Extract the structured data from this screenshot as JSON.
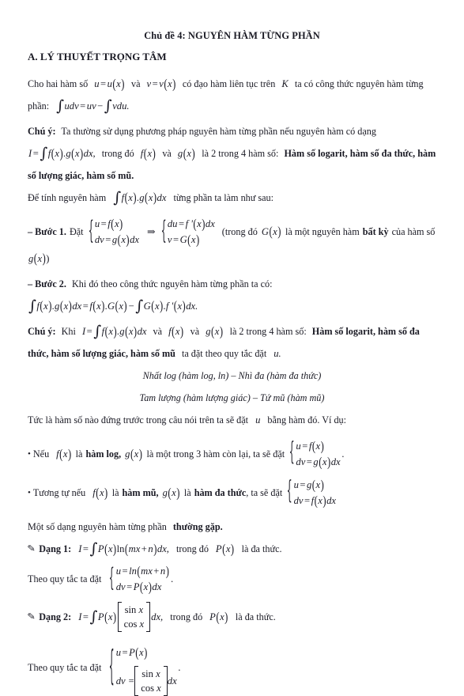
{
  "document": {
    "title": "Chủ đề 4: NGUYÊN HÀM TỪNG PHẦN",
    "section_heading": "A. LÝ THUYẾT TRỌNG TÂM",
    "intro": {
      "p1_a": "Cho hai hàm số",
      "p1_m1": "u = u(x)",
      "p1_b": "và",
      "p1_m2": "v = v(x)",
      "p1_c": "có đạo hàm liên tục trên",
      "p1_m3": "K",
      "p1_d": "ta có công thức nguyên hàm từng",
      "p2_a": "phần:",
      "p2_m": "∫udv = uv − ∫vdu."
    },
    "note1": {
      "label": "Chú ý:",
      "text_a": "Ta thường sử dụng phương pháp nguyên hàm từng phần nếu nguyên hàm có dạng",
      "formula": "I = ∫f(x).g(x)dx,",
      "text_b": "trong đó",
      "fx": "f(x)",
      "va": "và",
      "gx": "g(x)",
      "text_c": "là 2 trong 4 hàm số:",
      "bold_a": "Hàm số logarit, hàm số đa thức, hàm",
      "bold_b": "số lượng giác, hàm số mũ."
    },
    "de_tinh": {
      "a": "Để tính nguyên hàm",
      "m": "∫f(x).g(x)dx",
      "b": "từng phần ta làm như sau:"
    },
    "buoc1": {
      "label": "– Bước 1.",
      "dat": "Đặt",
      "sys_left": [
        "u = f(x)",
        "dv = g(x)dx"
      ],
      "arrow": "⇒",
      "sys_right": [
        "du = f '(x)dx",
        "v = G(x)"
      ],
      "tail_a": "(trong đó",
      "Gx": "G(x)",
      "tail_b": "là một nguyên hàm",
      "tail_bold": "bất kỳ",
      "tail_c": "của hàm số",
      "tail_d": "g(x))"
    },
    "buoc2": {
      "label": "– Bước 2.",
      "text": "Khi đó theo công thức nguyên hàm từng phần ta có:",
      "formula": "∫f(x).g(x)dx = f(x).G(x) − ∫G(x).f '(x)dx."
    },
    "note2": {
      "label": "Chú ý:",
      "khi": "Khi",
      "I": "I = ∫f(x).g(x)dx",
      "va1": "và",
      "fx": "f(x)",
      "va2": "và",
      "gx": "g(x)",
      "text_c": "là 2 trong 4 hàm số:",
      "bold_a": "Hàm số logarit, hàm số đa",
      "bold_b": "thức, hàm số lượng giác, hàm số mũ",
      "tail": "ta đặt theo quy tắc đặt",
      "u": "u."
    },
    "rhyme": {
      "line1": "Nhất log (hàm log, ln) – Nhì đa (hàm đa thức)",
      "line2": "Tam lượng (hàm lượng giác) – Tứ mũ (hàm mũ)"
    },
    "tuc_la": {
      "a": "Tức là hàm số nào đứng trước trong câu nói trên ta sẽ đặt",
      "u": "u",
      "b": "bằng hàm đó. Ví dụ:"
    },
    "bullets": [
      {
        "dot": "•",
        "a": "Nếu",
        "fx": "f(x)",
        "b": "là",
        "bold1": "hàm log,",
        "gx": "g(x)",
        "c": "là một trong 3 hàm còn lại, ta sẽ đặt",
        "sys": [
          "u = f(x)",
          "dv = g(x)dx"
        ],
        "period": "."
      },
      {
        "dot": "•",
        "a": "Tương tự nếu",
        "fx": "f(x)",
        "b": "là",
        "bold1": "hàm mũ,",
        "gx": "g(x)",
        "c": "là",
        "bold2": "hàm đa thức",
        "d": ", ta sẽ đặt",
        "sys": [
          "u = g(x)",
          "dv = f(x)dx"
        ],
        "period": ""
      }
    ],
    "mot_so_dang": {
      "a": "Một số dạng nguyên hàm từng phần",
      "bold": "thường gặp."
    },
    "dang1": {
      "quill": "✎",
      "label": "Dạng 1:",
      "formula": "I = ∫P(x)ln(mx + n)dx,",
      "tail_a": "trong đó",
      "Px": "P(x)",
      "tail_b": "là đa thức.",
      "rule_label": "Theo quy tắc ta đặt",
      "sys": [
        "u = ln(mx + n)",
        "dv = P(x)dx"
      ],
      "period": "."
    },
    "dang2": {
      "quill": "✎",
      "label": "Dạng 2:",
      "formula_pre": "I = ∫P(x)",
      "bracket": [
        "sin x",
        "cos x"
      ],
      "formula_post": "dx,",
      "tail_a": "trong đó",
      "Px": "P(x)",
      "tail_b": "là đa thức.",
      "rule_label": "Theo quy tắc ta đặt",
      "sys_row1": "u = P(x)",
      "sys_row2_pre": "dv =",
      "sys_row2_bracket": [
        "sin x",
        "cos x"
      ],
      "sys_row2_post": "dx",
      "period": "."
    },
    "colors": {
      "text": "#1a1a24",
      "background": "#ffffff"
    }
  }
}
